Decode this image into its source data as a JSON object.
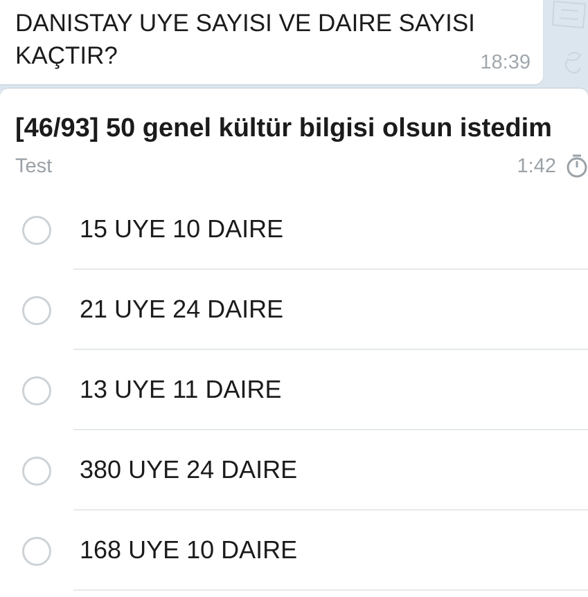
{
  "message": {
    "text": "DANISTAY UYE SAYISI VE DAIRE SAYISI\nKAÇTIR?",
    "time": "18:39"
  },
  "poll": {
    "question": "[46/93] 50 genel kültür bilgisi olsun istedim",
    "type_label": "Test",
    "timer": "1:42",
    "timer_icon": "stopwatch-icon",
    "options": [
      {
        "label": "15 UYE 10 DAIRE"
      },
      {
        "label": "21 UYE 24 DAIRE"
      },
      {
        "label": "13 UYE 11 DAIRE"
      },
      {
        "label": "380 UYE 24 DAIRE"
      },
      {
        "label": "168 UYE 10 DAIRE"
      }
    ]
  },
  "colors": {
    "chat_background": "#dce6ee",
    "bubble": "#ffffff",
    "text": "#1b1b1b",
    "muted_text": "#9aa1a7",
    "radio_border": "#cdd2d6",
    "divider": "#e6e9ec"
  }
}
